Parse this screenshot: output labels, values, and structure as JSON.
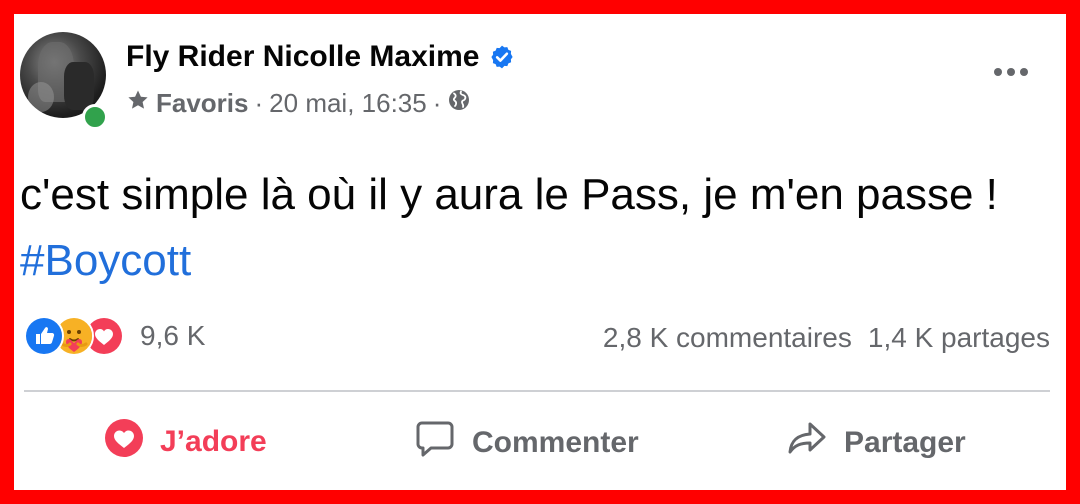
{
  "post": {
    "author": "Fly Rider Nicolle Maxime",
    "audience_label": "Favoris",
    "separator": "·",
    "timestamp": "20 mai, 16:35",
    "text_main": "c'est simple là où il y aura le Pass, je m'en passe ! ",
    "hashtag": "#Boycott"
  },
  "stats": {
    "reactions_count": "9,6 K",
    "comments": "2,8 K commentaires",
    "shares": "1,4 K partages"
  },
  "actions": {
    "love_label": "J’adore",
    "comment_label": "Commenter",
    "share_label": "Partager"
  },
  "colors": {
    "frame": "#ff0000",
    "hashtag": "#216fdb",
    "verified": "#1877f2",
    "online": "#31a24c",
    "love": "#f33e58",
    "like": "#1877f2"
  },
  "icons": {
    "verified": "verified-badge-icon",
    "favorite": "star-icon",
    "audience": "globe-icon",
    "more": "more-options-icon",
    "like_reaction": "like-reaction-icon",
    "care_reaction": "care-reaction-icon",
    "love_reaction": "love-reaction-icon",
    "love_action": "heart-icon",
    "comment_action": "comment-bubble-icon",
    "share_action": "share-arrow-icon"
  }
}
